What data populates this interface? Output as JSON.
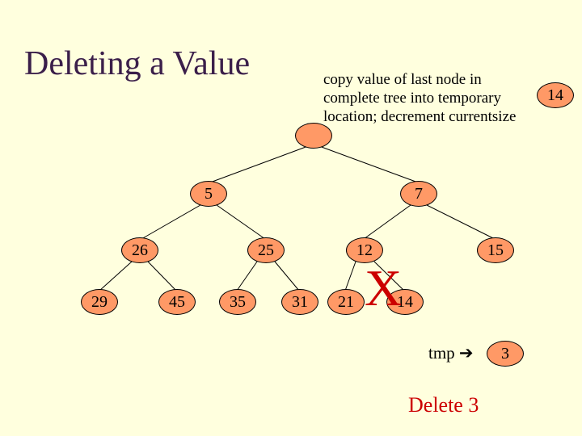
{
  "title": "Deleting a Value",
  "caption": "copy value of last node in complete tree into temporary location; decrement  currentsize",
  "nodes": {
    "root": "",
    "n5": "5",
    "n7": "7",
    "n26": "26",
    "n25": "25",
    "n12": "12",
    "n15": "15",
    "n29": "29",
    "n45": "45",
    "n35": "35",
    "n31": "31",
    "n21": "21",
    "n14b": "14",
    "n14a": "14",
    "n3": "3"
  },
  "cross": "X",
  "tmp_label": "tmp",
  "arrow": "➔",
  "delete_label": "Delete 3"
}
